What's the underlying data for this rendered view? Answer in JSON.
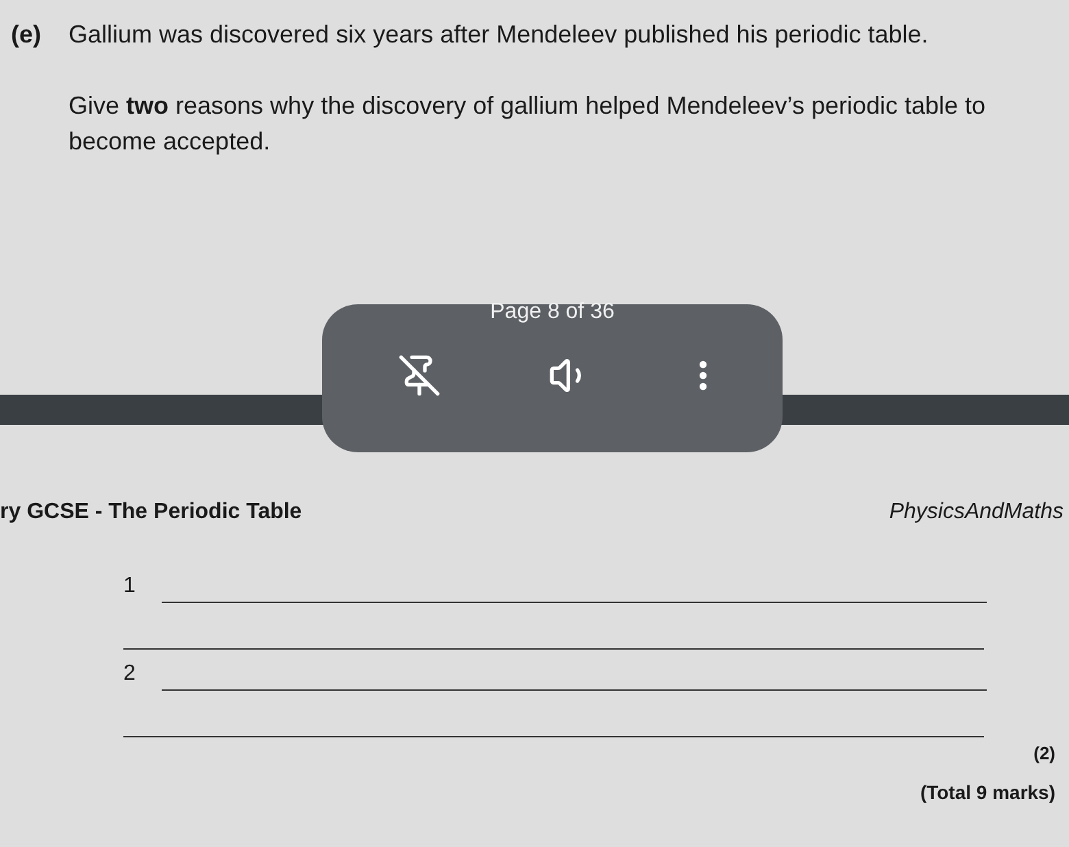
{
  "question": {
    "label": "(e)",
    "intro": "Gallium was discovered six years after Mendeleev published his periodic table.",
    "prompt": "Give **two** reasons why the discovery of gallium helped Mendeleev’s periodic table to become accepted."
  },
  "viewer": {
    "page_indicator": "Page 8 of 36"
  },
  "footer": {
    "left": "ry GCSE - The Periodic Table",
    "right": "PhysicsAndMaths"
  },
  "answers": [
    {
      "number": "1"
    },
    {
      "number": "2"
    }
  ],
  "marks": "(2)",
  "total": "(Total 9 marks)"
}
